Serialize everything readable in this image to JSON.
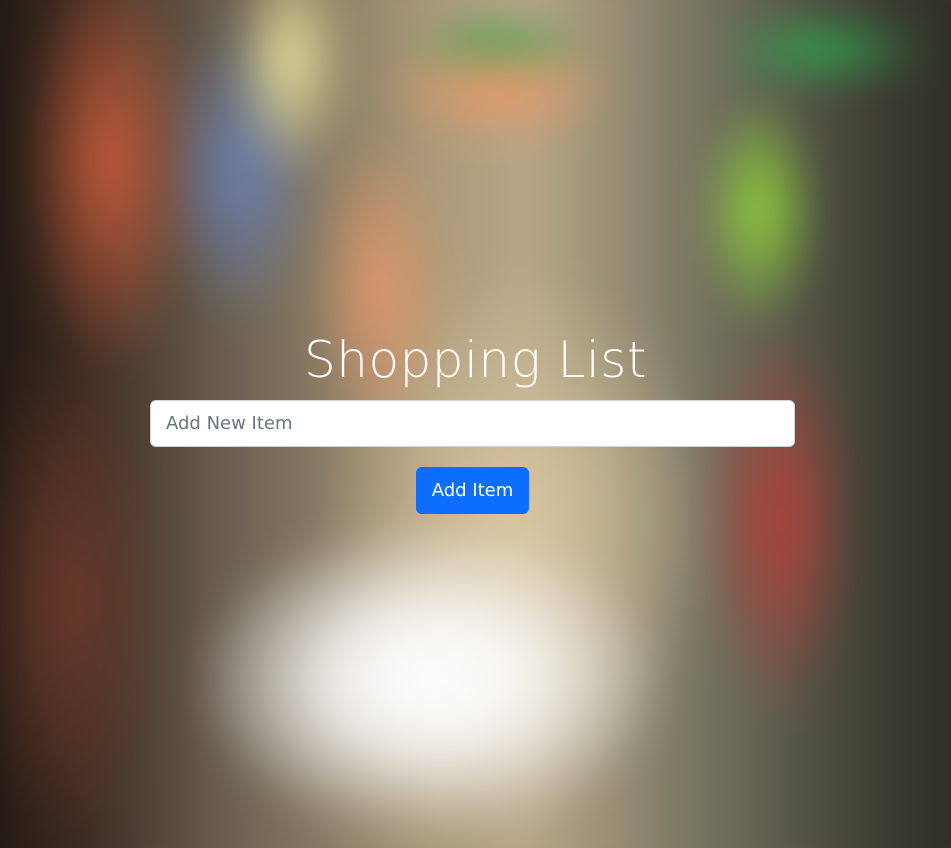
{
  "app": {
    "title": "Shopping List"
  },
  "form": {
    "new_item_placeholder": "Add New Item",
    "new_item_value": "",
    "add_button_label": "Add Item"
  },
  "colors": {
    "button_primary": "#0d6efd",
    "title_text": "#ffffff"
  }
}
